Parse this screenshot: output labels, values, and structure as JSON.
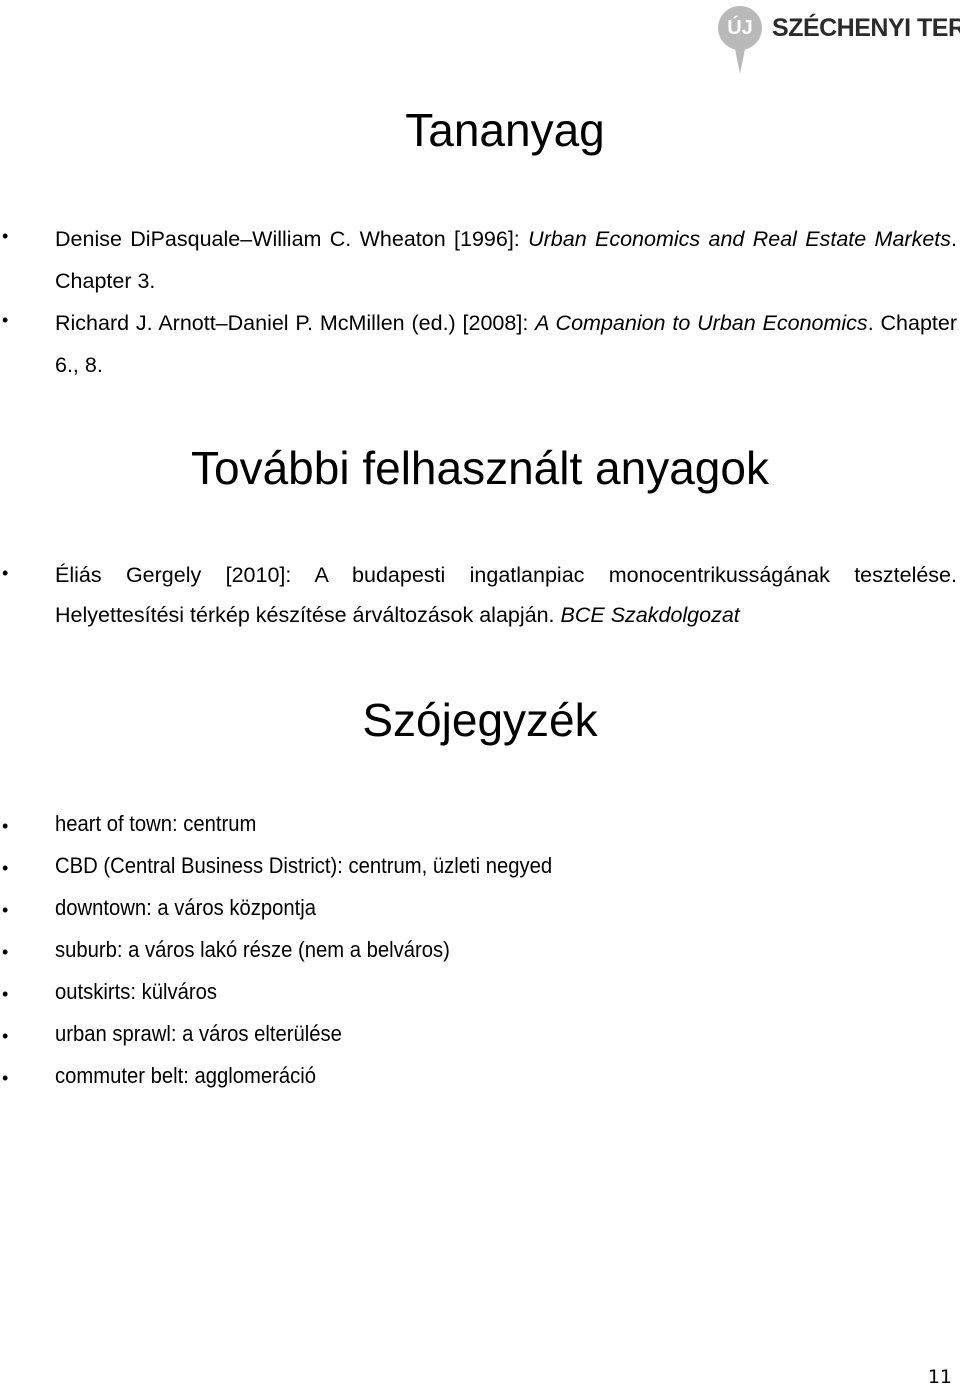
{
  "logo": {
    "pin_text": "ÚJ",
    "brand": "SZÉCHENYI TERV"
  },
  "sections": {
    "tananyag": {
      "title": "Tananyag",
      "refs": [
        {
          "authors": "Denise DiPasquale–William C. Wheaton [1996]: ",
          "title": "Urban Economics and Real Estate Markets",
          "rest": ". Chapter 3."
        },
        {
          "authors": "Richard J. Arnott–Daniel P. McMillen (ed.) [2008]: ",
          "title": "A Companion to Urban Economics",
          "rest": ". Chapter 6., 8."
        }
      ]
    },
    "tovabbi": {
      "title": "További felhasznált anyagok",
      "refs": [
        {
          "text": "Éliás Gergely [2010]: A budapesti ingatlanpiac monocentrikusságának tesztelése. Helyettesítési térkép készítése árváltozások alapján. ",
          "italic": "BCE Szakdolgozat"
        }
      ]
    },
    "szojegyzek": {
      "title": "Szójegyzék",
      "items": [
        "heart of town: centrum",
        "CBD (Central Business District): centrum, üzleti negyed",
        "downtown: a város központja",
        "suburb: a város lakó része (nem a belváros)",
        "outskirts: külváros",
        "urban sprawl: a város elterülése",
        "commuter belt: agglomeráció"
      ]
    }
  },
  "page_number": "11",
  "bullet": "•"
}
